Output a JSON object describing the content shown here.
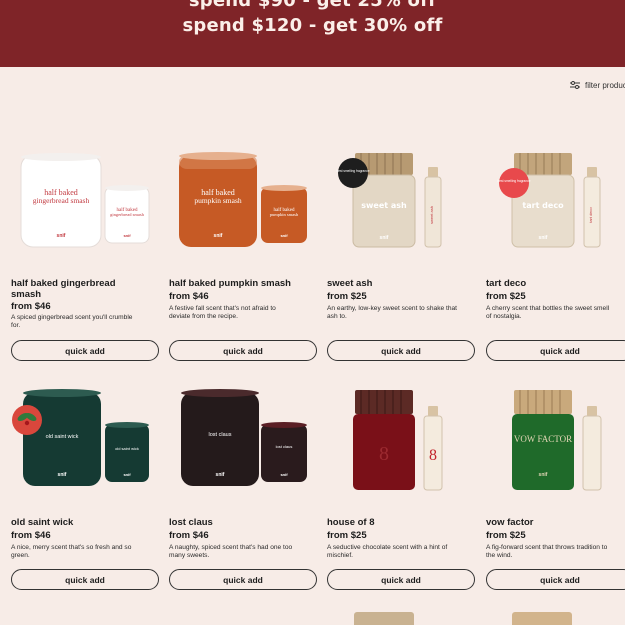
{
  "promo": {
    "line1": "spend $90 - get 25% off",
    "line2": "spend $120 - get 30% off",
    "bg_color": "#7f2428"
  },
  "filter": {
    "label": "filter products",
    "icon": "sliders-icon"
  },
  "colors": {
    "background": "#f7ece7",
    "accent": "#7f2428",
    "text": "#1d1d1d"
  },
  "products": [
    {
      "name_line1": "half baked gingerbread",
      "name_line2": "smash",
      "price": "from $46",
      "desc_line1": "A spiced gingerbread scent you'll crumble",
      "desc_line2": "for.",
      "button": "quick add",
      "label_main": "half baked",
      "label_sub": "gingerbread smash",
      "brand": "snif"
    },
    {
      "name_line1": "half baked pumpkin smash",
      "name_line2": "",
      "price": "from $46",
      "desc_line1": "A festive fall scent that's not afraid to",
      "desc_line2": "deviate from the recipe.",
      "button": "quick add",
      "label_main": "half baked",
      "label_sub": "pumpkin smash",
      "brand": "snif"
    },
    {
      "name_line1": "sweet ash",
      "name_line2": "",
      "price": "from $25",
      "desc_line1": "An earthy, low-key sweet scent to shake that",
      "desc_line2": "ash to.",
      "button": "quick add",
      "label_main": "sweet ash",
      "label_sub": "",
      "brand": "snif",
      "badge": "best smelling fragrance"
    },
    {
      "name_line1": "tart deco",
      "name_line2": "",
      "price": "from $25",
      "desc_line1": "A cherry scent that bottles the sweet smell",
      "desc_line2": "of nostalgia.",
      "button": "quick add",
      "label_main": "tart deco",
      "label_sub": "",
      "brand": "snif",
      "badge": "best smelling fragrance"
    },
    {
      "name_line1": "old saint wick",
      "name_line2": "",
      "price": "from $46",
      "desc_line1": "A nice, merry scent that's so fresh and so",
      "desc_line2": "green.",
      "button": "quick add",
      "label_main": "old saint wick",
      "label_sub": "",
      "brand": "snif"
    },
    {
      "name_line1": "lost claus",
      "name_line2": "",
      "price": "from $46",
      "desc_line1": "A naughty, spiced scent that's had one too",
      "desc_line2": "many sweets.",
      "button": "quick add",
      "label_main": "lost claus",
      "label_sub": "",
      "brand": "snif"
    },
    {
      "name_line1": "house of 8",
      "name_line2": "",
      "price": "from $25",
      "desc_line1": "A seductive chocolate scent with a hint of",
      "desc_line2": "mischief.",
      "button": "quick add",
      "label_main": "8",
      "label_sub": "",
      "brand": "snif"
    },
    {
      "name_line1": "vow factor",
      "name_line2": "",
      "price": "from $25",
      "desc_line1": "A fig-forward scent that throws tradition to",
      "desc_line2": "the wind.",
      "button": "quick add",
      "label_main": "VOW FACTOR",
      "label_sub": "",
      "brand": "snif"
    }
  ]
}
